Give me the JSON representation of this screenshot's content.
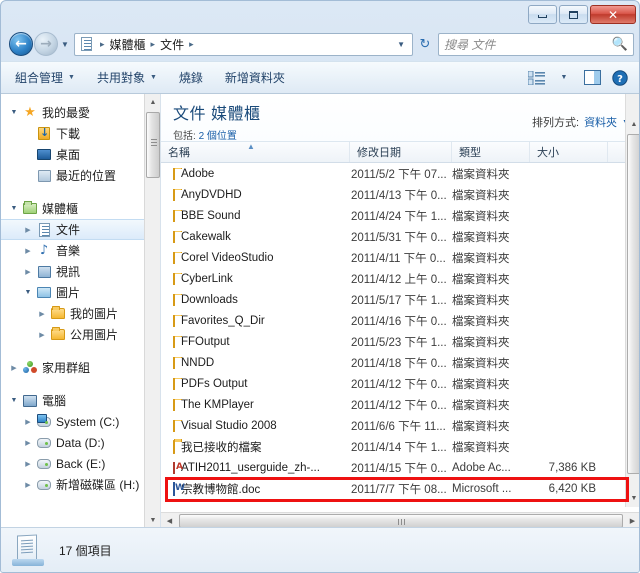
{
  "window": {
    "buttons": {
      "minimize": "minimize-button",
      "maximize": "maximize-button",
      "close": "✕"
    }
  },
  "address": {
    "back_glyph": "←",
    "forward_glyph": "→",
    "history_caret": "▼",
    "crumbs": [
      "媒體櫃",
      "文件"
    ],
    "separator": "▸",
    "dropdown_caret": "▼",
    "refresh_glyph": "↻",
    "search_placeholder": "搜尋 文件",
    "search_value": "",
    "search_icon": "search-icon"
  },
  "toolbar": {
    "items": [
      {
        "label": "組合管理",
        "caret": "▼"
      },
      {
        "label": "共用對象",
        "caret": "▼"
      },
      {
        "label": "燒錄",
        "caret": ""
      },
      {
        "label": "新增資料夾",
        "caret": ""
      }
    ],
    "view_caret": "▼",
    "help_glyph": "?"
  },
  "sidebar": {
    "items": [
      {
        "label": "我的最愛",
        "icon": "star-icon",
        "indent": 0,
        "expander": "▼",
        "selected": false
      },
      {
        "label": "下載",
        "icon": "download-folder-icon",
        "indent": 1,
        "expander": "",
        "selected": false
      },
      {
        "label": "桌面",
        "icon": "desktop-icon",
        "indent": 1,
        "expander": "",
        "selected": false
      },
      {
        "label": "最近的位置",
        "icon": "recent-places-icon",
        "indent": 1,
        "expander": "",
        "selected": false
      },
      {
        "label": "媒體櫃",
        "icon": "library-icon",
        "indent": 0,
        "expander": "▼",
        "selected": false
      },
      {
        "label": "文件",
        "icon": "documents-icon",
        "indent": 1,
        "expander": "▶",
        "selected": true
      },
      {
        "label": "音樂",
        "icon": "music-icon",
        "indent": 1,
        "expander": "▶",
        "selected": false
      },
      {
        "label": "視訊",
        "icon": "video-icon",
        "indent": 1,
        "expander": "▶",
        "selected": false
      },
      {
        "label": "圖片",
        "icon": "pictures-icon",
        "indent": 1,
        "expander": "▼",
        "selected": false
      },
      {
        "label": "我的圖片",
        "icon": "folder-icon",
        "indent": 2,
        "expander": "▶",
        "selected": false
      },
      {
        "label": "公用圖片",
        "icon": "folder-icon",
        "indent": 2,
        "expander": "▶",
        "selected": false
      },
      {
        "label": "家用群組",
        "icon": "homegroup-icon",
        "indent": 0,
        "expander": "▶",
        "selected": false
      },
      {
        "label": "電腦",
        "icon": "computer-icon",
        "indent": 0,
        "expander": "▼",
        "selected": false
      },
      {
        "label": "System (C:)",
        "icon": "system-drive-icon",
        "indent": 1,
        "expander": "▶",
        "selected": false
      },
      {
        "label": "Data (D:)",
        "icon": "drive-icon",
        "indent": 1,
        "expander": "▶",
        "selected": false
      },
      {
        "label": "Back (E:)",
        "icon": "drive-icon",
        "indent": 1,
        "expander": "▶",
        "selected": false
      },
      {
        "label": "新增磁碟區 (H:)",
        "icon": "drive-icon",
        "indent": 1,
        "expander": "▶",
        "selected": false
      }
    ]
  },
  "main": {
    "library_title": "文件 媒體櫃",
    "includes_prefix": "包括:",
    "includes_count": "2 個位置",
    "arrange_label": "排列方式:",
    "arrange_value": "資料夾",
    "arrange_caret": "▼",
    "columns": [
      {
        "label": "名稱",
        "key": "name"
      },
      {
        "label": "修改日期",
        "key": "date"
      },
      {
        "label": "類型",
        "key": "type"
      },
      {
        "label": "大小",
        "key": "size"
      }
    ],
    "sort_indicator": "▲",
    "rows": [
      {
        "name": "Adobe",
        "date": "2011/5/2 下午 07...",
        "type": "檔案資料夾",
        "size": "",
        "icon": "folder-icon"
      },
      {
        "name": "AnyDVDHD",
        "date": "2011/4/13 下午 0...",
        "type": "檔案資料夾",
        "size": "",
        "icon": "folder-icon"
      },
      {
        "name": "BBE Sound",
        "date": "2011/4/24 下午 1...",
        "type": "檔案資料夾",
        "size": "",
        "icon": "folder-icon"
      },
      {
        "name": "Cakewalk",
        "date": "2011/5/31 下午 0...",
        "type": "檔案資料夾",
        "size": "",
        "icon": "folder-icon"
      },
      {
        "name": "Corel VideoStudio",
        "date": "2011/4/11 下午 0...",
        "type": "檔案資料夾",
        "size": "",
        "icon": "folder-icon"
      },
      {
        "name": "CyberLink",
        "date": "2011/4/12 上午 0...",
        "type": "檔案資料夾",
        "size": "",
        "icon": "folder-icon"
      },
      {
        "name": "Downloads",
        "date": "2011/5/17 下午 1...",
        "type": "檔案資料夾",
        "size": "",
        "icon": "folder-icon"
      },
      {
        "name": "Favorites_Q_Dir",
        "date": "2011/4/16 下午 0...",
        "type": "檔案資料夾",
        "size": "",
        "icon": "folder-icon"
      },
      {
        "name": "FFOutput",
        "date": "2011/5/23 下午 1...",
        "type": "檔案資料夾",
        "size": "",
        "icon": "folder-icon"
      },
      {
        "name": "NNDD",
        "date": "2011/4/18 下午 0...",
        "type": "檔案資料夾",
        "size": "",
        "icon": "folder-icon"
      },
      {
        "name": "PDFs Output",
        "date": "2011/4/12 下午 0...",
        "type": "檔案資料夾",
        "size": "",
        "icon": "folder-icon"
      },
      {
        "name": "The KMPlayer",
        "date": "2011/4/12 下午 0...",
        "type": "檔案資料夾",
        "size": "",
        "icon": "folder-icon"
      },
      {
        "name": "Visual Studio 2008",
        "date": "2011/6/6 下午 11...",
        "type": "檔案資料夾",
        "size": "",
        "icon": "folder-icon"
      },
      {
        "name": "我已接收的檔案",
        "date": "2011/4/14 下午 1...",
        "type": "檔案資料夾",
        "size": "",
        "icon": "folder-icon"
      },
      {
        "name": "ATIH2011_userguide_zh-...",
        "date": "2011/4/15 下午 0...",
        "type": "Adobe Ac...",
        "size": "7,386 KB",
        "icon": "pdf-icon"
      },
      {
        "name": "宗教博物館.doc",
        "date": "2011/7/7 下午 08...",
        "type": "Microsoft ...",
        "size": "6,420 KB",
        "icon": "word-icon"
      }
    ],
    "highlighted_row_index": 15,
    "highlight_color": "#ee1111"
  },
  "status": {
    "item_count_text": "17 個項目",
    "icon": "documents-status-icon"
  },
  "scrollbars": {
    "up_arrow": "▲",
    "down_arrow": "▼",
    "left_arrow": "◀",
    "right_arrow": "▶"
  }
}
